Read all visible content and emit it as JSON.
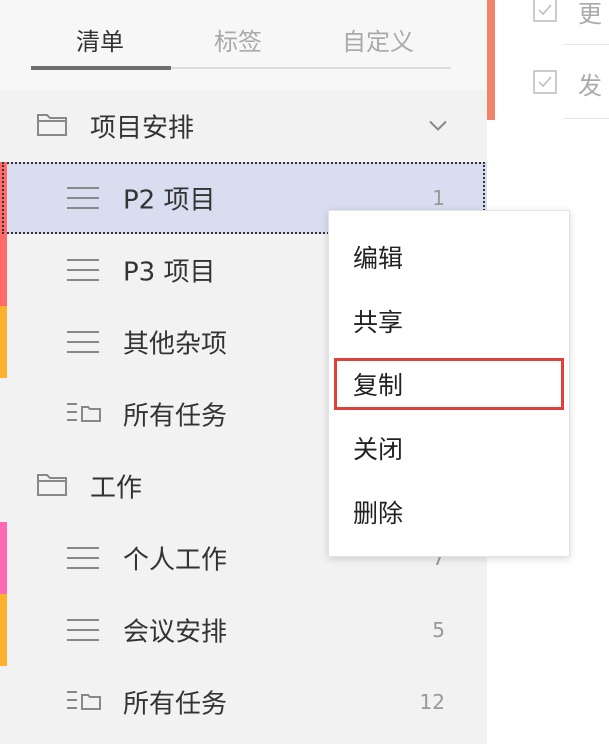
{
  "tabs": [
    {
      "label": "清单",
      "active": true
    },
    {
      "label": "标签",
      "active": false
    },
    {
      "label": "自定义",
      "active": false
    }
  ],
  "groups": [
    {
      "name": "项目安排",
      "icon": "folder-icon",
      "expanded": true,
      "lists": [
        {
          "name": "P2 项目",
          "count": "1",
          "color": "#ff6b6b",
          "icon": "list-lines-icon",
          "selected": true
        },
        {
          "name": "P3 项目",
          "count": "",
          "color": "#ff6b6b",
          "icon": "list-lines-icon"
        },
        {
          "name": "其他杂项",
          "count": "",
          "color": "#ffb02e",
          "icon": "list-lines-icon"
        },
        {
          "name": "所有任务",
          "count": "",
          "color": "",
          "icon": "all-tasks-icon"
        }
      ]
    },
    {
      "name": "工作",
      "icon": "folder-icon",
      "lists": [
        {
          "name": "个人工作",
          "count": "7",
          "color": "#ff69b4",
          "icon": "list-lines-icon"
        },
        {
          "name": "会议安排",
          "count": "5",
          "color": "#ffb02e",
          "icon": "list-lines-icon"
        },
        {
          "name": "所有任务",
          "count": "12",
          "color": "",
          "icon": "all-tasks-icon"
        }
      ]
    }
  ],
  "tasks": [
    {
      "text": "更"
    },
    {
      "text": "发"
    }
  ],
  "context_menu": {
    "items": [
      {
        "label": "编辑"
      },
      {
        "label": "共享"
      },
      {
        "label": "复制",
        "highlighted": true
      },
      {
        "label": "关闭"
      },
      {
        "label": "删除"
      }
    ]
  },
  "colors": {
    "selected_row_bg": "#d8def0",
    "highlight_border": "#e0403a",
    "right_accent": "#f2846a"
  }
}
